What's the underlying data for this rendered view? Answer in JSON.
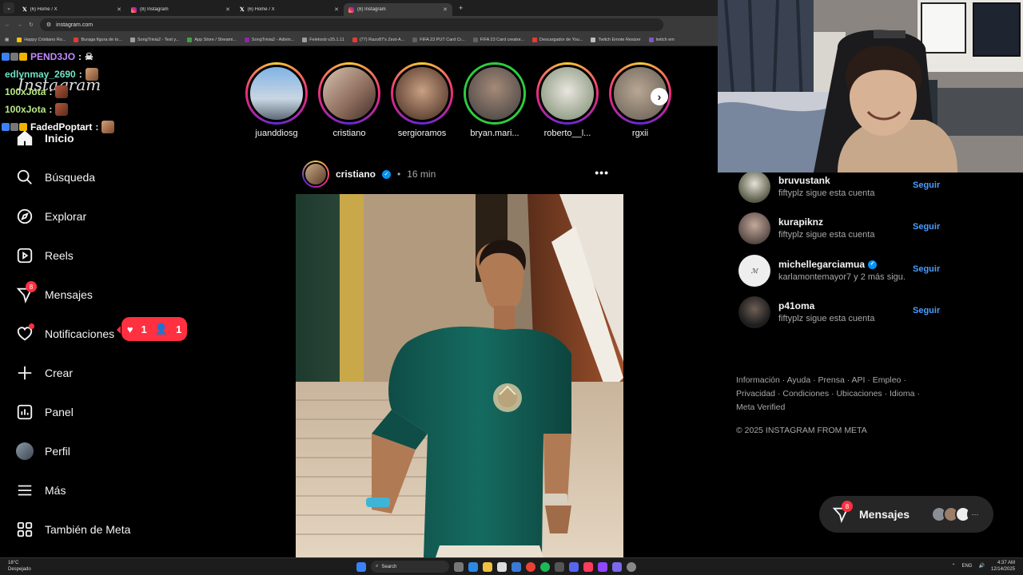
{
  "browser": {
    "tabs": [
      {
        "title": "(6) Home / X",
        "icon": "x-logo-icon",
        "active": false
      },
      {
        "title": "(8) Instagram",
        "icon": "instagram-icon",
        "active": false
      },
      {
        "title": "(6) Home / X",
        "icon": "x-logo-icon",
        "active": false
      },
      {
        "title": "(8) Instagram",
        "icon": "instagram-icon",
        "active": true
      }
    ],
    "new_tab": "+",
    "url": "instagram.com",
    "bookmarks": [
      "Happy Cristiano Ro...",
      "Buraga figura de to...",
      "SongTrivia2 - Test y...",
      "App Store / Streami...",
      "SongTrivia2 - Adivin...",
      "Feletoob v25.1.11",
      "(77) Razo87's Zest-A...",
      "FIFA 23 PUT Card Cr...",
      "FIFA 23 Card creator...",
      "Descargador de You...",
      "Twitch Emote Resizer",
      "twitch em"
    ]
  },
  "chat_overlay": {
    "lines": [
      {
        "user": "PEND3JO",
        "color": "#c28cff",
        "msg": ":"
      },
      {
        "user": "edlynmay_2690",
        "color": "#6fe3c6",
        "msg": ":"
      },
      {
        "user": "100xJota",
        "color": "#b8e986",
        "msg": ":"
      },
      {
        "user": "100xJota",
        "color": "#b8e986",
        "msg": ":"
      },
      {
        "user": "FadedPoptart",
        "color": "#ffffff",
        "msg": ":"
      }
    ]
  },
  "sidebar": {
    "wordmark": "Instagram",
    "items": [
      {
        "label": "Inicio",
        "icon": "home-icon"
      },
      {
        "label": "Búsqueda",
        "icon": "search-icon"
      },
      {
        "label": "Explorar",
        "icon": "compass-icon"
      },
      {
        "label": "Reels",
        "icon": "reels-icon"
      },
      {
        "label": "Mensajes",
        "icon": "messenger-icon",
        "badge": "8"
      },
      {
        "label": "Notificaciones",
        "icon": "heart-icon"
      },
      {
        "label": "Crear",
        "icon": "plus-icon"
      },
      {
        "label": "Panel",
        "icon": "dashboard-icon"
      },
      {
        "label": "Perfil",
        "icon": "profile-avatar"
      },
      {
        "label": "Más",
        "icon": "menu-icon"
      },
      {
        "label": "También de Meta",
        "icon": "meta-apps-icon"
      }
    ],
    "notification_pill": {
      "likes": "1",
      "follows": "1"
    }
  },
  "stories": [
    {
      "name": "juanddiosg",
      "close_friend": false
    },
    {
      "name": "cristiano",
      "close_friend": false
    },
    {
      "name": "sergioramos",
      "close_friend": false
    },
    {
      "name": "bryan.mari...",
      "close_friend": true
    },
    {
      "name": "roberto__l...",
      "close_friend": false
    },
    {
      "name": "rgxii",
      "close_friend": false
    }
  ],
  "post": {
    "user": "cristiano",
    "verified": true,
    "separator": "•",
    "time": "16 min",
    "more": "•••"
  },
  "suggestions": [
    {
      "user": "bruvustank",
      "sub": "fiftyplz sigue esta cuenta",
      "verified": false,
      "action": "Seguir",
      "avatar": "#5b5d4a"
    },
    {
      "user": "kurapiknz",
      "sub": "fiftyplz sigue esta cuenta",
      "verified": false,
      "action": "Seguir",
      "avatar": "#6a5a55"
    },
    {
      "user": "michellegarciamua",
      "sub": "karlamontemayor7 y 2 más sigu...",
      "verified": true,
      "action": "Seguir",
      "avatar": "#eeeeee"
    },
    {
      "user": "p41oma",
      "sub": "fiftyplz sigue esta cuenta",
      "verified": false,
      "action": "Seguir",
      "avatar": "#2a2a2a"
    }
  ],
  "footer": {
    "links_line1": "Información · Ayuda · Prensa · API · Empleo ·",
    "links_line2": "Privacidad · Condiciones · Ubicaciones · Idioma ·",
    "links_line3": "Meta Verified",
    "copyright": "© 2025 INSTAGRAM FROM META"
  },
  "messages_pill": {
    "label": "Mensajes",
    "badge": "8"
  },
  "taskbar": {
    "weather_temp": "18°C",
    "weather_desc": "Despejado",
    "search": "Search",
    "lang": "ENG",
    "time": "4:37 AM",
    "date": "12/14/2025"
  }
}
